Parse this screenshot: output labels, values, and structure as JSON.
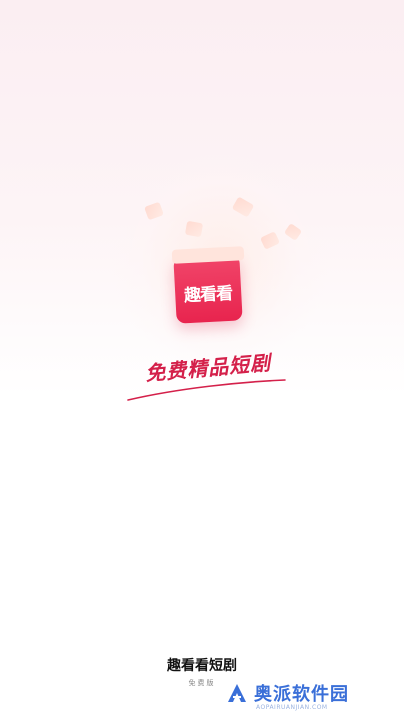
{
  "splash": {
    "app_icon_text": "趣看看",
    "slogan": "免费精品短剧",
    "app_name": "趣看看短剧",
    "subtitle": "免费版"
  },
  "watermark": {
    "text": "奥派软件园",
    "url": "AOPAIRUANJIAN.COM"
  },
  "colors": {
    "brand": "#e8244e",
    "background_top": "#fbeef2",
    "watermark": "#3a6fd8"
  }
}
